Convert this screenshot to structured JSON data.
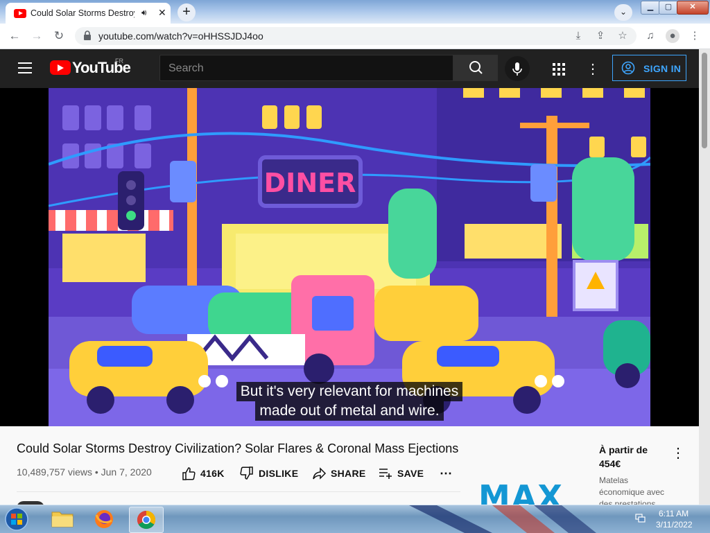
{
  "browser": {
    "tab_title": "Could Solar Storms Destroy Civilization? Solar Flares & Coronal Mass Ejections",
    "new_tab": "+",
    "tab_search": "⌄",
    "url": "youtube.com/watch?v=oHHSSJDJ4oo",
    "window_controls": {
      "minimize": "▁",
      "maximize": "▢",
      "close": "✕"
    },
    "nav": {
      "back": "←",
      "forward": "→",
      "reload": "↻"
    }
  },
  "youtube": {
    "logo_text": "YouTube",
    "country_code": "FR",
    "search_placeholder": "Search",
    "sign_in_label": "SIGN IN",
    "accent_color": "#3ea6ff",
    "brand_color": "#ff0000"
  },
  "video": {
    "caption_line1": "But it's very relevant for machines",
    "caption_line2": "made out of metal and wire.",
    "title": "Could Solar Storms Destroy Civilization? Solar Flares & Coronal Mass Ejections",
    "views_date": "10,489,757 views • Jun 7, 2020",
    "actions": {
      "like": "416K",
      "dislike": "DISLIKE",
      "share": "SHARE",
      "save": "SAVE"
    }
  },
  "ad": {
    "logo": "MAX",
    "price_line1": "À partir de",
    "price_line2": "454€",
    "description": "Matelas économique avec des prestations"
  },
  "taskbar": {
    "time": "6:11 AM",
    "date": "3/11/2022",
    "apps": [
      "file-explorer",
      "firefox",
      "chrome"
    ]
  }
}
